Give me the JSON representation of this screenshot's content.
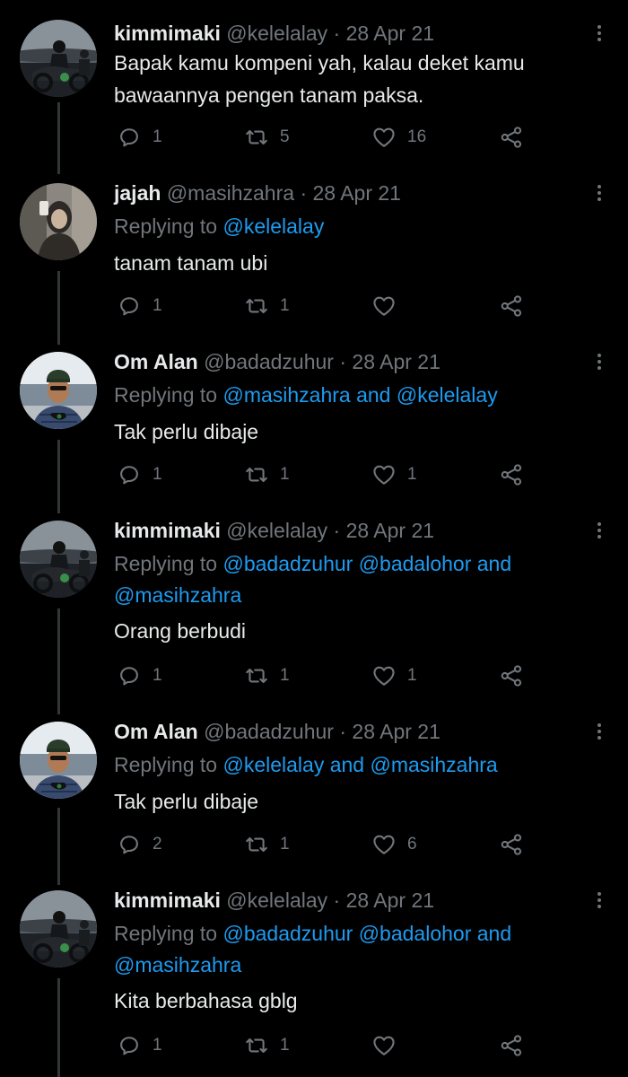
{
  "colors": {
    "background": "#000000",
    "text": "#e7e9ea",
    "muted": "#71767b",
    "link": "#1d9bf0",
    "thread_line": "#333639"
  },
  "icons": {
    "reply": "reply-icon",
    "retweet": "retweet-icon",
    "like": "heart-icon",
    "share": "share-icon",
    "more": "more-icon"
  },
  "tweets": [
    {
      "name": "kimmimaki",
      "handle": "@kelelalay",
      "sep": "·",
      "date": "28 Apr 21",
      "replying": null,
      "text": [
        "Bapak kamu kompeni yah, kalau deket kamu",
        "bawaannya pengen tanam paksa."
      ],
      "replies": "1",
      "retweets": "5",
      "likes": "16"
    },
    {
      "name": "jajah",
      "handle": "@masihzahra",
      "sep": "·",
      "date": "28 Apr 21",
      "replying": {
        "prefix": "Replying to ",
        "line1": "@kelelalay",
        "line2": ""
      },
      "text": [
        "tanam tanam ubi"
      ],
      "replies": "1",
      "retweets": "1",
      "likes": ""
    },
    {
      "name": "Om Alan",
      "handle": "@badadzuhur",
      "sep": "·",
      "date": "28 Apr 21",
      "replying": {
        "prefix": "Replying to ",
        "line1": "@masihzahra and @kelelalay",
        "line2": ""
      },
      "text": [
        "Tak perlu dibaje"
      ],
      "replies": "1",
      "retweets": "1",
      "likes": "1"
    },
    {
      "name": "kimmimaki",
      "handle": "@kelelalay",
      "sep": "·",
      "date": "28 Apr 21",
      "replying": {
        "prefix": "Replying to ",
        "line1": "@badadzuhur @badalohor and",
        "line2": "@masihzahra"
      },
      "text": [
        "Orang berbudi"
      ],
      "replies": "1",
      "retweets": "1",
      "likes": "1"
    },
    {
      "name": "Om Alan",
      "handle": "@badadzuhur",
      "sep": "·",
      "date": "28 Apr 21",
      "replying": {
        "prefix": "Replying to ",
        "line1": "@kelelalay and @masihzahra",
        "line2": ""
      },
      "text": [
        "Tak perlu dibaje"
      ],
      "replies": "2",
      "retweets": "1",
      "likes": "6"
    },
    {
      "name": "kimmimaki",
      "handle": "@kelelalay",
      "sep": "·",
      "date": "28 Apr 21",
      "replying": {
        "prefix": "Replying to ",
        "line1": "@badadzuhur @badalohor and",
        "line2": "@masihzahra"
      },
      "text": [
        "Kita berbahasa gblg"
      ],
      "replies": "1",
      "retweets": "1",
      "likes": ""
    }
  ]
}
